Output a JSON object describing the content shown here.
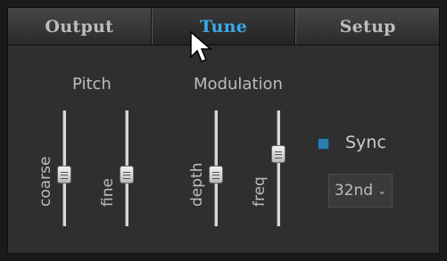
{
  "tabs": [
    {
      "label": "Output",
      "active": false
    },
    {
      "label": "Tune",
      "active": true
    },
    {
      "label": "Setup",
      "active": false
    }
  ],
  "sections": {
    "pitch": "Pitch",
    "modulation": "Modulation"
  },
  "sliders": [
    {
      "label": "coarse",
      "level": 0.45
    },
    {
      "label": "fine",
      "level": 0.45
    },
    {
      "label": "depth",
      "level": 0.45
    },
    {
      "label": "freq",
      "level": 0.62
    }
  ],
  "sync": {
    "label": "Sync",
    "checked": true,
    "value": "32nd"
  },
  "colors": {
    "accent": "#3aa9e8",
    "checkbox": "#2c7eb0",
    "background": "#2f2f2f"
  },
  "icons": {
    "cursor": "mouse-pointer-icon",
    "dropdown": "chevron-down-icon"
  }
}
